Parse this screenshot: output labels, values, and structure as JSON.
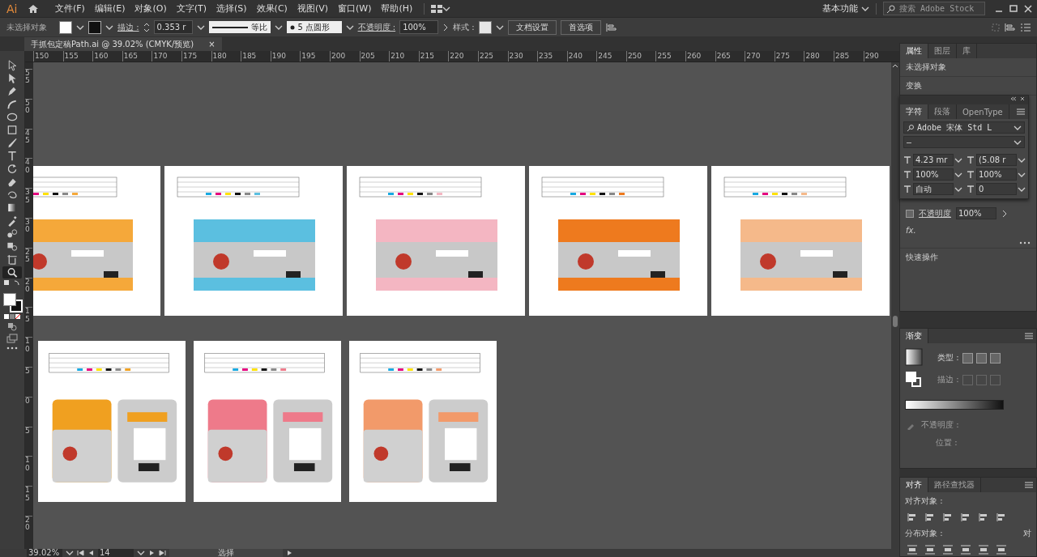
{
  "app": {
    "logo": "Ai",
    "menus": [
      "文件(F)",
      "编辑(E)",
      "对象(O)",
      "文字(T)",
      "选择(S)",
      "效果(C)",
      "视图(V)",
      "窗口(W)",
      "帮助(H)"
    ],
    "workspace": "基本功能",
    "search": {
      "placeholder": "搜索 Adobe Stock"
    }
  },
  "control_bar": {
    "selection": "未选择对象",
    "stroke_label": "描边 :",
    "stroke_value": "0.353 r",
    "profile": "等比",
    "brush": "5 点圆形",
    "opacity_label": "不透明度 :",
    "opacity_value": "100%",
    "style_label": "样式 :",
    "buttons": [
      "文档设置",
      "首选项"
    ]
  },
  "document_tab": {
    "title": "手抓包定稿Path.ai @ 39.02% (CMYK/预览)",
    "close": "×"
  },
  "rulers": {
    "horizontal": [
      "150",
      "155",
      "160",
      "165",
      "170",
      "175",
      "180",
      "185",
      "190",
      "195",
      "200",
      "205",
      "210",
      "215",
      "220",
      "225",
      "230",
      "235",
      "240",
      "245",
      "250",
      "255",
      "260",
      "265",
      "270",
      "275",
      "280",
      "285",
      "290"
    ],
    "vertical": [
      "55",
      "50",
      "45",
      "40",
      "35",
      "30",
      "25",
      "20",
      "15",
      "10",
      "5",
      "0",
      "5",
      "10",
      "15",
      "20"
    ]
  },
  "tools": [
    {
      "selected": false
    },
    {
      "selected": false
    },
    {
      "selected": false
    },
    {
      "selected": false
    },
    {
      "selected": false
    },
    {
      "selected": false
    },
    {
      "selected": false
    },
    {
      "selected": false
    },
    {
      "selected": false
    },
    {
      "selected": false
    },
    {
      "selected": false
    },
    {
      "selected": false
    },
    {
      "selected": false
    },
    {
      "selected": false
    },
    {
      "selected": false
    },
    {
      "selected": false
    },
    {
      "selected": true
    }
  ],
  "canvas": {
    "artboards": [
      {
        "kind": "landscape",
        "color": "#f5a83a"
      },
      {
        "kind": "landscape",
        "color": "#5bbfe0"
      },
      {
        "kind": "landscape",
        "color": "#f4b6c2"
      },
      {
        "kind": "landscape",
        "color": "#ee7a1e"
      },
      {
        "kind": "landscape",
        "color": "#f5b98a"
      },
      {
        "kind": "portrait",
        "color": "#f0a020"
      },
      {
        "kind": "portrait",
        "color": "#ee7a8a"
      },
      {
        "kind": "portrait",
        "color": "#f29a6a"
      }
    ]
  },
  "properties_panel": {
    "tabs": [
      {
        "label": "属性",
        "selected": true
      },
      {
        "label": "图层",
        "selected": false
      },
      {
        "label": "库",
        "selected": false
      }
    ],
    "selection": "未选择对象",
    "transform": "变换",
    "opacity_label": "不透明度",
    "opacity_value": "100%",
    "fx": "fx.",
    "quick_actions": "快速操作"
  },
  "character_panel": {
    "tabs": [
      {
        "label": "字符",
        "selected": true
      },
      {
        "label": "段落",
        "selected": false
      },
      {
        "label": "OpenType",
        "selected": false
      }
    ],
    "font": "Adobe 宋体 Std L",
    "style": "–",
    "fields": [
      "4.23 mr",
      "(5.08 r",
      "100%",
      "100%",
      "自动",
      "0"
    ]
  },
  "gradient_panel": {
    "title": "渐变",
    "type_label": "类型 :",
    "stroke_label": "描边 :",
    "opacity_label": "不透明度 :",
    "position_label": "位置 :"
  },
  "align_panel": {
    "tabs": [
      {
        "label": "对齐",
        "selected": true
      },
      {
        "label": "路径查找器",
        "selected": false
      }
    ],
    "align_label": "对齐对象 :",
    "distribute_label": "分布对象 :",
    "cut_panel_label": "对"
  },
  "status_bar": {
    "zoom": "39.02%",
    "artboard": "14",
    "tool": "选择"
  }
}
